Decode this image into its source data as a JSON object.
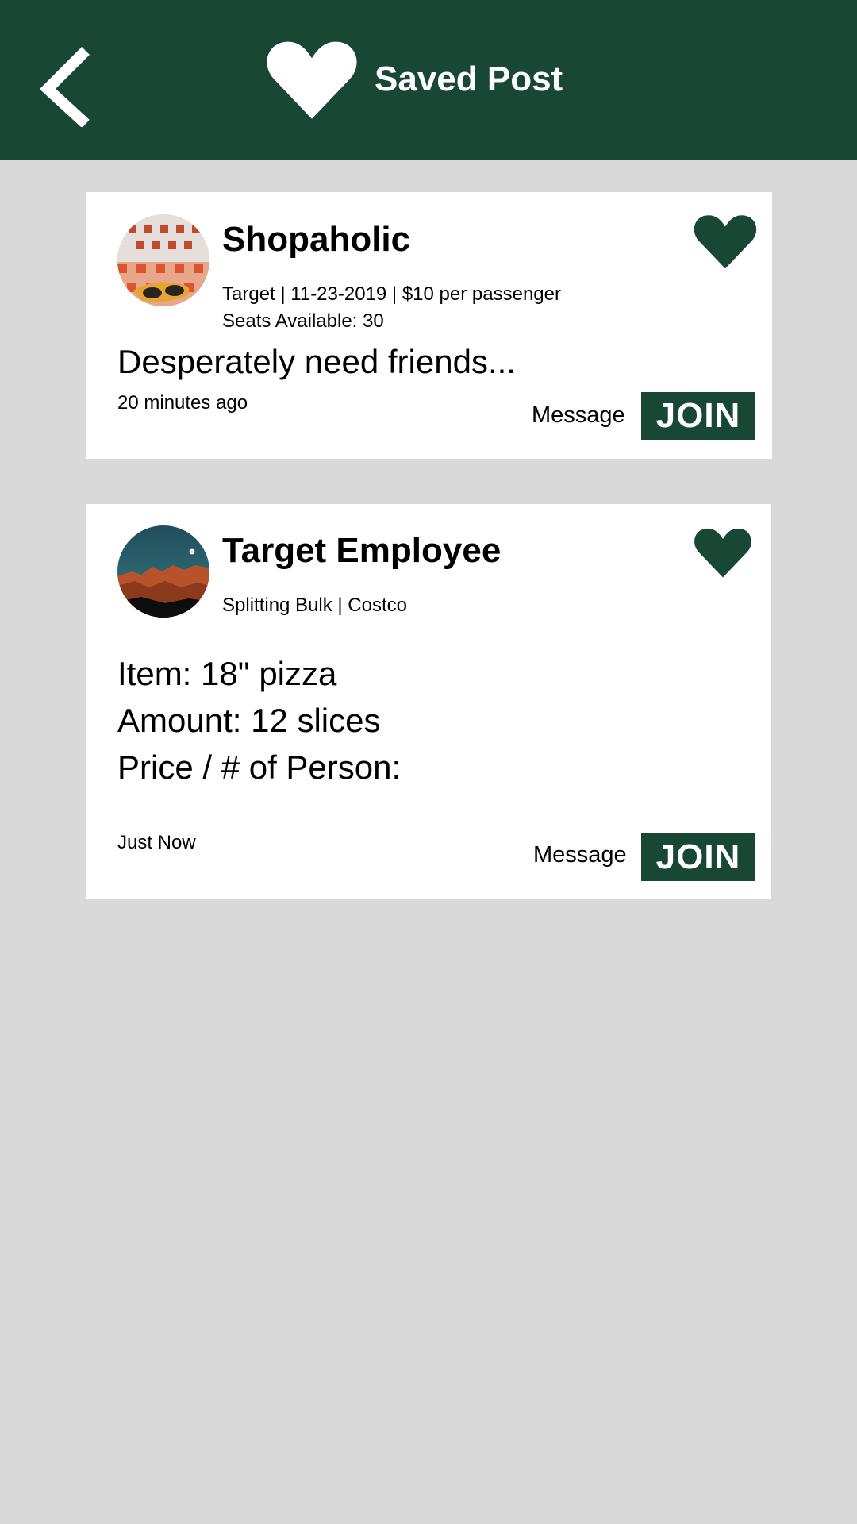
{
  "header": {
    "title": "Saved Post",
    "back_icon": "chevron-left-icon",
    "title_icon": "heart-icon",
    "background": "#184834"
  },
  "posts": [
    {
      "name": "Shopaholic",
      "meta_line1": "Target | 11-23-2019 | $10 per passenger",
      "meta_line2": "Seats Available: 30",
      "body": [
        "Desperately need friends..."
      ],
      "time": "20 minutes ago",
      "message_label": "Message",
      "join_label": "JOIN",
      "saved": true,
      "avatar": "checkered-tablecloth-sunglasses-photo"
    },
    {
      "name": "Target Employee",
      "meta_line1": "Splitting Bulk | Costco",
      "body": [
        "Item: 18\" pizza",
        "Amount: 12 slices",
        "Price / # of Person:"
      ],
      "time": "Just Now",
      "message_label": "Message",
      "join_label": "JOIN",
      "saved": true,
      "avatar": "mountain-night-sky-photo"
    }
  ],
  "colors": {
    "accent": "#184834",
    "page_background": "#d9d9d9",
    "card_background": "#ffffff"
  }
}
